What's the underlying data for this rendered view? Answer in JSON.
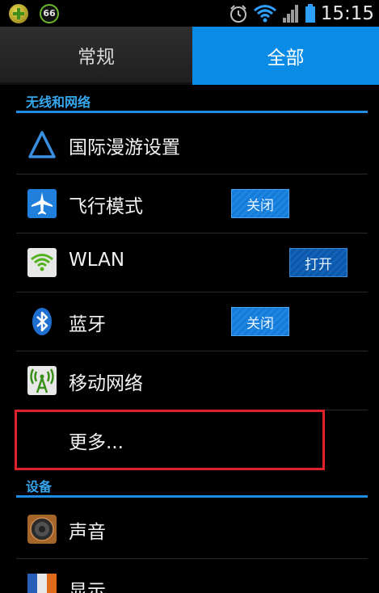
{
  "status_bar": {
    "badge_number": "66",
    "time": "15:15"
  },
  "tabs": [
    {
      "label": "常规",
      "selected": false
    },
    {
      "label": "全部",
      "selected": true
    }
  ],
  "sections": {
    "wireless": "无线和网络",
    "device": "设备"
  },
  "rows": {
    "roaming": {
      "label": "国际漫游设置",
      "icon": "roaming-triangle-icon"
    },
    "airplane": {
      "label": "飞行模式",
      "icon": "airplane-icon",
      "toggle": "关闭"
    },
    "wlan": {
      "label": "WLAN",
      "icon": "wifi-icon",
      "toggle": "打开"
    },
    "bluetooth": {
      "label": "蓝牙",
      "icon": "bluetooth-icon",
      "toggle": "关闭"
    },
    "mobile": {
      "label": "移动网络",
      "icon": "mobile-network-icon"
    },
    "more": {
      "label": "更多..."
    },
    "sound": {
      "label": "声音",
      "icon": "speaker-icon"
    },
    "display": {
      "label": "显示",
      "icon": "display-icon"
    }
  },
  "colors": {
    "accent": "#0a8ce6",
    "section_text": "#36a7ef",
    "highlight_border": "#e0202a"
  }
}
